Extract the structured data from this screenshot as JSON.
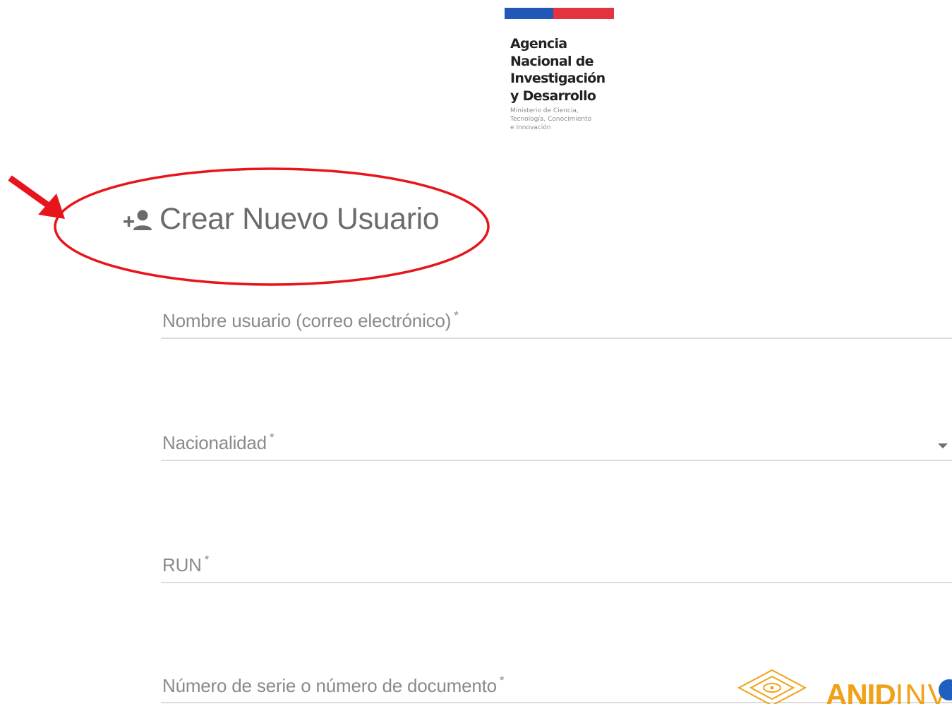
{
  "header": {
    "logo": {
      "name_lines": [
        "Agencia",
        "Nacional de",
        "Investigación",
        "y Desarrollo"
      ],
      "ministry_lines": [
        "Ministerio de Ciencia,",
        "Tecnología, Conocimiento",
        "e Innovación"
      ],
      "flag_colors": [
        "#1f58b5",
        "#e5323f"
      ]
    }
  },
  "page": {
    "title": "Crear Nuevo Usuario",
    "title_icon": "person-add-icon"
  },
  "form": {
    "fields": [
      {
        "label": "Nombre usuario (correo electrónico)",
        "required_mark": "*",
        "value": ""
      },
      {
        "label": "Nacionalidad",
        "required_mark": "*",
        "value": "",
        "type": "select"
      },
      {
        "label": "RUN",
        "required_mark": "*",
        "value": ""
      },
      {
        "label": "Número de serie o número de documento",
        "required_mark": "*",
        "value": ""
      }
    ]
  },
  "footer": {
    "brand_logo": {
      "text_bold": "ANID",
      "text_light": "INV",
      "color": "#f0a118"
    }
  },
  "annotations": {
    "highlight_color": "#e8141c"
  }
}
